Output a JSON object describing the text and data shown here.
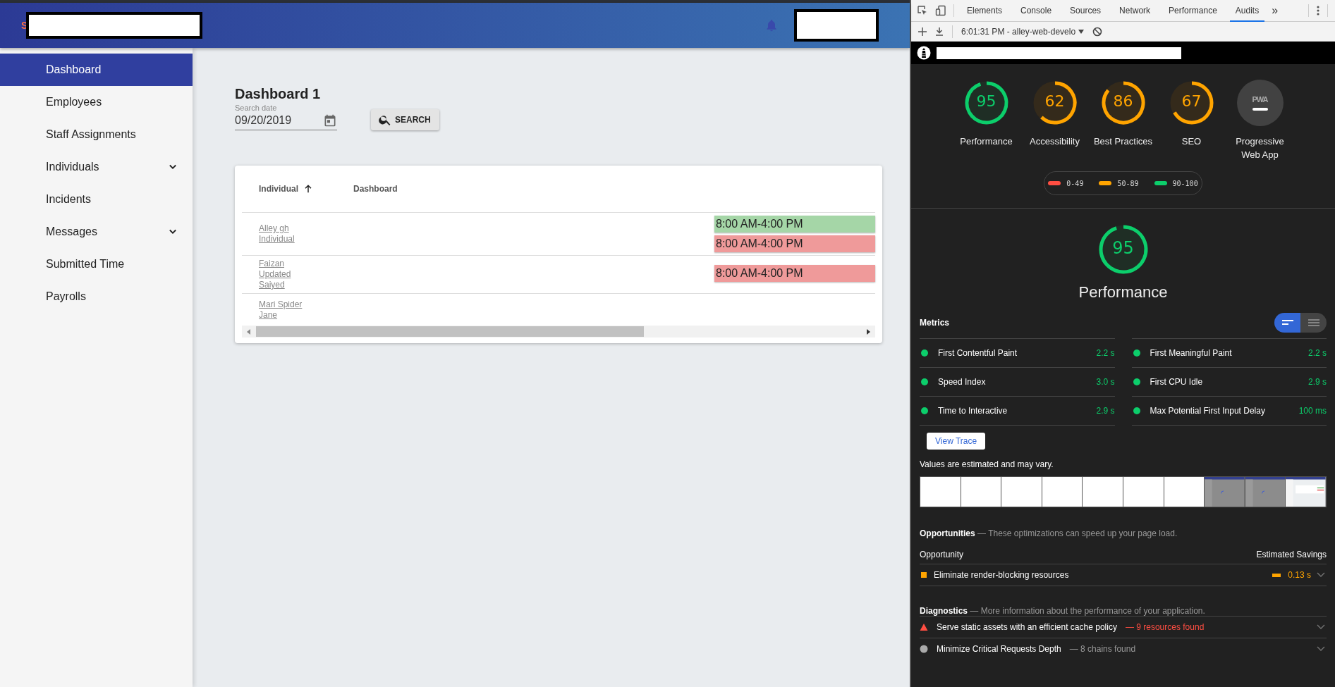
{
  "header": {
    "brand_letter": "S"
  },
  "sidebar": {
    "items": [
      {
        "label": "Dashboard",
        "selected": true,
        "expandable": false
      },
      {
        "label": "Employees",
        "selected": false,
        "expandable": false
      },
      {
        "label": "Staff Assignments",
        "selected": false,
        "expandable": false
      },
      {
        "label": "Individuals",
        "selected": false,
        "expandable": true
      },
      {
        "label": "Incidents",
        "selected": false,
        "expandable": false
      },
      {
        "label": "Messages",
        "selected": false,
        "expandable": true
      },
      {
        "label": "Submitted Time",
        "selected": false,
        "expandable": false
      },
      {
        "label": "Payrolls",
        "selected": false,
        "expandable": false
      }
    ]
  },
  "page": {
    "title": "Dashboard 1",
    "date_field": {
      "label": "Search date",
      "value": "09/20/2019"
    },
    "search_button": "SEARCH"
  },
  "table": {
    "columns": [
      {
        "label": "Individual",
        "sorted": true
      },
      {
        "label": "Dashboard",
        "sorted": false
      }
    ],
    "rows": [
      {
        "name": "Alley gh Individual",
        "shifts": [
          {
            "time": "8:00 AM-4:00 PM",
            "color": "#a5d6a7"
          },
          {
            "time": "8:00 AM-4:00 PM",
            "color": "#ef9a9a"
          }
        ]
      },
      {
        "name": "Faizan Updated Saiyed",
        "shifts": [
          {
            "time": "8:00 AM-4:00 PM",
            "color": "#ef9a9a"
          }
        ]
      },
      {
        "name": "Mari Spider Jane",
        "shifts": []
      }
    ]
  },
  "devtools": {
    "tabs": [
      {
        "label": "Elements",
        "selected": false
      },
      {
        "label": "Console",
        "selected": false
      },
      {
        "label": "Sources",
        "selected": false
      },
      {
        "label": "Network",
        "selected": false
      },
      {
        "label": "Performance",
        "selected": false
      },
      {
        "label": "Audits",
        "selected": true
      }
    ],
    "more_tabs": "»",
    "report_select": "6:01:31 PM - alley-web-develo",
    "gauges": [
      {
        "kind": "score",
        "score": "95",
        "label": "Performance"
      },
      {
        "kind": "score",
        "score": "62",
        "label": "Accessibility"
      },
      {
        "kind": "score",
        "score": "86",
        "label": "Best Practices"
      },
      {
        "kind": "score",
        "score": "67",
        "label": "SEO"
      },
      {
        "kind": "pwa",
        "badge": "PWA",
        "label": "Progressive Web App"
      }
    ],
    "legend": [
      {
        "range": "0-49",
        "color": "#ff4e42"
      },
      {
        "range": "50-89",
        "color": "#ffa400"
      },
      {
        "range": "90-100",
        "color": "#0cce6b"
      }
    ],
    "category": {
      "score": "95",
      "title": "Performance"
    },
    "metrics_title": "Metrics",
    "metric_views": [
      {
        "selected": true
      },
      {
        "selected": false
      }
    ],
    "metrics": [
      {
        "name": "First Contentful Paint",
        "value": "2.2 s",
        "color": "#0cce6b"
      },
      {
        "name": "First Meaningful Paint",
        "value": "2.2 s",
        "color": "#0cce6b"
      },
      {
        "name": "Speed Index",
        "value": "3.0 s",
        "color": "#0cce6b"
      },
      {
        "name": "First CPU Idle",
        "value": "2.9 s",
        "color": "#0cce6b"
      },
      {
        "name": "Time to Interactive",
        "value": "2.9 s",
        "color": "#0cce6b"
      },
      {
        "name": "Max Potential First Input Delay",
        "value": "100 ms",
        "color": "#0cce6b"
      }
    ],
    "view_trace": "View Trace",
    "note": "Values are estimated and may vary.",
    "filmstrip": [
      {
        "kind": "blank"
      },
      {
        "kind": "blank"
      },
      {
        "kind": "blank"
      },
      {
        "kind": "blank"
      },
      {
        "kind": "blank"
      },
      {
        "kind": "blank"
      },
      {
        "kind": "blank"
      },
      {
        "kind": "loading"
      },
      {
        "kind": "loading"
      },
      {
        "kind": "loaded"
      }
    ],
    "opportunities": {
      "title": "Opportunities",
      "description": "— These optimizations can speed up your page load.",
      "col_1": "Opportunity",
      "col_2": "Estimated Savings",
      "items": [
        {
          "name": "Eliminate render-blocking resources",
          "savings": "0.13 s"
        }
      ]
    },
    "diagnostics": {
      "title": "Diagnostics",
      "description": "— More information about the performance of your application.",
      "items": [
        {
          "kind": "fail",
          "name": "Serve static assets with an efficient cache policy",
          "detail": "— 9 resources found"
        },
        {
          "kind": "info",
          "name": "Minimize Critical Requests Depth",
          "detail": "— 8 chains found"
        }
      ]
    }
  }
}
